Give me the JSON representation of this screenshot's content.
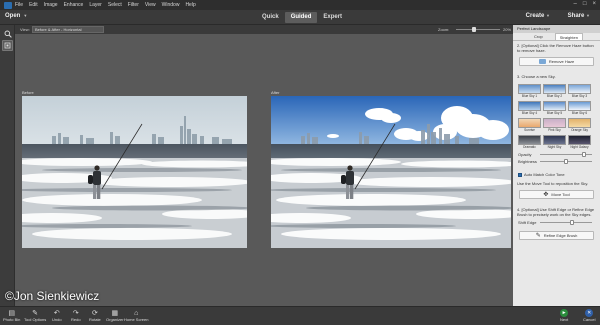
{
  "menu": [
    "File",
    "Edit",
    "Image",
    "Enhance",
    "Layer",
    "Select",
    "Filter",
    "View",
    "Window",
    "Help"
  ],
  "window_controls": [
    "–",
    "□",
    "×"
  ],
  "mode_bar": {
    "open": "Open",
    "modes": [
      "Quick",
      "Guided",
      "Expert"
    ],
    "active_mode": "Guided",
    "create": "Create",
    "share": "Share"
  },
  "options": {
    "view_label": "View:",
    "view_value": "Before & After - Horizontal",
    "zoom_label": "Zoom:",
    "zoom_value": "20%",
    "zoom_level": 0.4
  },
  "canvas": {
    "before_label": "Before",
    "after_label": "After",
    "credit": "©Jon Sienkiewicz"
  },
  "panel": {
    "title": "Perfect Landscape",
    "tabs": [
      "Crop",
      "Straighten"
    ],
    "step2": "2. [Optional] Click the Remove Haze button to remove haze.",
    "remove_haze": "Remove Haze",
    "step3": "3. Choose a new Sky.",
    "skies": [
      {
        "label": "Blue Sky 1",
        "top": "#5f8fc8",
        "bottom": "#c9dcf0"
      },
      {
        "label": "Blue Sky 2",
        "top": "#4a7fc0",
        "bottom": "#dce8f5"
      },
      {
        "label": "Blue Sky 3",
        "top": "#7aa5d8",
        "bottom": "#eef3f9"
      },
      {
        "label": "Blue Sky 4",
        "top": "#3f77ba",
        "bottom": "#b9d2ec"
      },
      {
        "label": "Blue Sky 5",
        "top": "#5c8cc9",
        "bottom": "#e3edf7"
      },
      {
        "label": "Blue Sky 6",
        "top": "#6a9bd3",
        "bottom": "#f0f5fb"
      },
      {
        "label": "Sunrise",
        "top": "#f2d7b6",
        "bottom": "#e9a86e"
      },
      {
        "label": "Pink Sky",
        "top": "#c8b0c8",
        "bottom": "#e8c8d6"
      },
      {
        "label": "Orange Sky",
        "top": "#e2b26c",
        "bottom": "#f5d9a4"
      },
      {
        "label": "Dramatic",
        "top": "#3b3f47",
        "bottom": "#8b8f96"
      },
      {
        "label": "Night Sky",
        "top": "#2d3550",
        "bottom": "#6d7590"
      },
      {
        "label": "Night Galaxy",
        "top": "#1c1f2e",
        "bottom": "#5a5670"
      }
    ],
    "opacity_label": "Opacity",
    "opacity_level": 0.85,
    "brightness_label": "Brightness",
    "brightness_level": 0.5,
    "auto_match": "Auto Match Color Tone",
    "move_note": "Use the Move Tool to reposition the Sky.",
    "move_tool": "Move Tool",
    "step4": "4. [Optional] Use Shift Edge or Refine Edge Brush to precisely work on the Sky edges.",
    "shift_edge_label": "Shift Edge",
    "shift_edge_level": 0.62,
    "refine_edge": "Refine Edge Brush"
  },
  "bottom": {
    "items": [
      {
        "label": "Photo Bin",
        "icon": "photo-bin-icon",
        "glyph": "▤"
      },
      {
        "label": "Tool Options",
        "icon": "tool-options-icon",
        "glyph": "✎"
      },
      {
        "label": "Undo",
        "icon": "undo-icon",
        "glyph": "↶"
      },
      {
        "label": "Redo",
        "icon": "redo-icon",
        "glyph": "↷"
      },
      {
        "label": "Rotate",
        "icon": "rotate-icon",
        "glyph": "⟳"
      },
      {
        "label": "Organizer",
        "icon": "organizer-icon",
        "glyph": "▦"
      },
      {
        "label": "Home Screen",
        "icon": "home-screen-icon",
        "glyph": "⌂"
      }
    ],
    "next": "Next",
    "cancel": "Cancel"
  },
  "colors": {
    "accent": "#2a6db0",
    "panel_bg": "#e8e8e8",
    "next_green": "#2a8c3c",
    "cancel_blue": "#2f5fa8"
  }
}
